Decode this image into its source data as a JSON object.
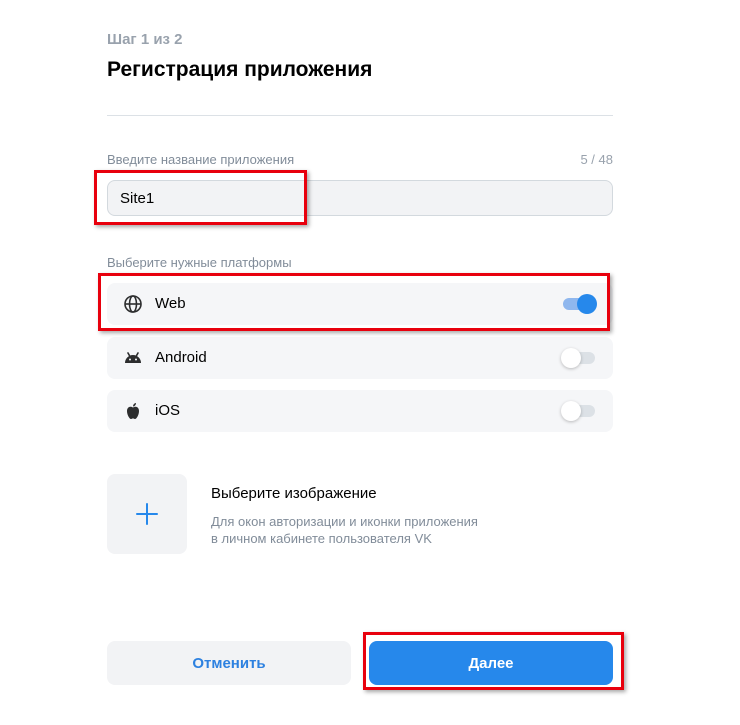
{
  "header": {
    "step": "Шаг 1 из 2",
    "title": "Регистрация приложения"
  },
  "app_name": {
    "label": "Введите название приложения",
    "counter": "5 / 48",
    "value": "Site1"
  },
  "platforms": {
    "label": "Выберите нужные платформы",
    "items": [
      {
        "name": "Web",
        "icon": "globe-icon",
        "enabled": true
      },
      {
        "name": "Android",
        "icon": "android-icon",
        "enabled": false
      },
      {
        "name": "iOS",
        "icon": "apple-icon",
        "enabled": false
      }
    ]
  },
  "image": {
    "title": "Выберите изображение",
    "description_line1": "Для окон авторизации и иконки приложения",
    "description_line2": "в личном кабинете пользователя VK",
    "icon": "plus-icon"
  },
  "buttons": {
    "cancel": "Отменить",
    "next": "Далее"
  },
  "colors": {
    "accent": "#2688eb",
    "highlight": "#e8000d",
    "secondary_text": "#818c99"
  }
}
